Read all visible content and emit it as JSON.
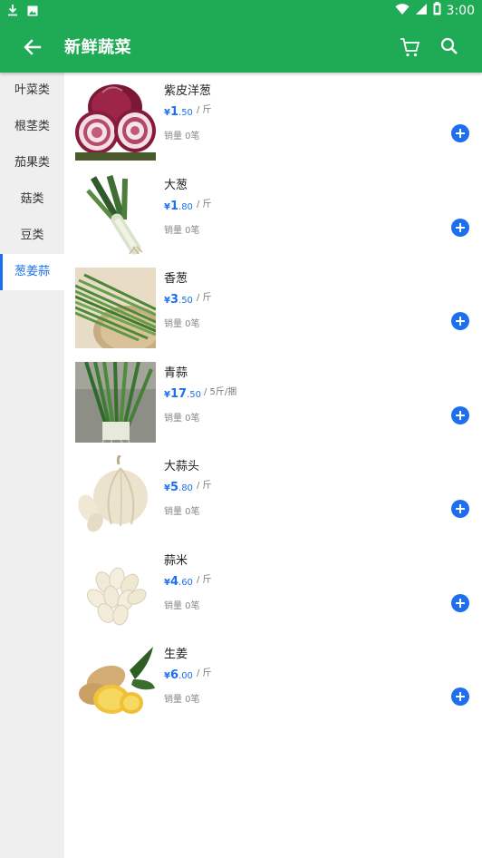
{
  "status_bar": {
    "time": "3:00",
    "icons": [
      "download-icon",
      "photo-icon",
      "wifi-icon",
      "signal-icon",
      "battery-icon"
    ]
  },
  "app_bar": {
    "title": "新鲜蔬菜",
    "icons": [
      "back-arrow-icon",
      "cart-icon",
      "search-icon"
    ]
  },
  "categories": [
    {
      "label": "叶菜类",
      "active": false
    },
    {
      "label": "根茎类",
      "active": false
    },
    {
      "label": "茄果类",
      "active": false
    },
    {
      "label": "菇类",
      "active": false
    },
    {
      "label": "豆类",
      "active": false
    },
    {
      "label": "葱姜蒜",
      "active": true
    }
  ],
  "products": [
    {
      "name": "紫皮洋葱",
      "currency": "¥",
      "price_int": "1",
      "price_dec": ".50",
      "unit": "/ 斤",
      "sales": "销量 0笔",
      "image": "red-onion"
    },
    {
      "name": "大葱",
      "currency": "¥",
      "price_int": "1",
      "price_dec": ".80",
      "unit": "/ 斤",
      "sales": "销量 0笔",
      "image": "leek"
    },
    {
      "name": "香葱",
      "currency": "¥",
      "price_int": "3",
      "price_dec": ".50",
      "unit": "/ 斤",
      "sales": "销量 0笔",
      "image": "scallion"
    },
    {
      "name": "青蒜",
      "currency": "¥",
      "price_int": "17",
      "price_dec": ".50",
      "unit": "/ 5斤/捆",
      "sales": "销量 0笔",
      "image": "green-garlic"
    },
    {
      "name": "大蒜头",
      "currency": "¥",
      "price_int": "5",
      "price_dec": ".80",
      "unit": "/ 斤",
      "sales": "销量 0笔",
      "image": "garlic-bulb"
    },
    {
      "name": "蒜米",
      "currency": "¥",
      "price_int": "4",
      "price_dec": ".60",
      "unit": "/ 斤",
      "sales": "销量 0笔",
      "image": "garlic-cloves"
    },
    {
      "name": "生姜",
      "currency": "¥",
      "price_int": "6",
      "price_dec": ".00",
      "unit": "/ 斤",
      "sales": "销量 0笔",
      "image": "ginger"
    }
  ],
  "colors": {
    "primary": "#1faa55",
    "accent": "#1e6ff0",
    "sidebar_bg": "#efefef"
  }
}
